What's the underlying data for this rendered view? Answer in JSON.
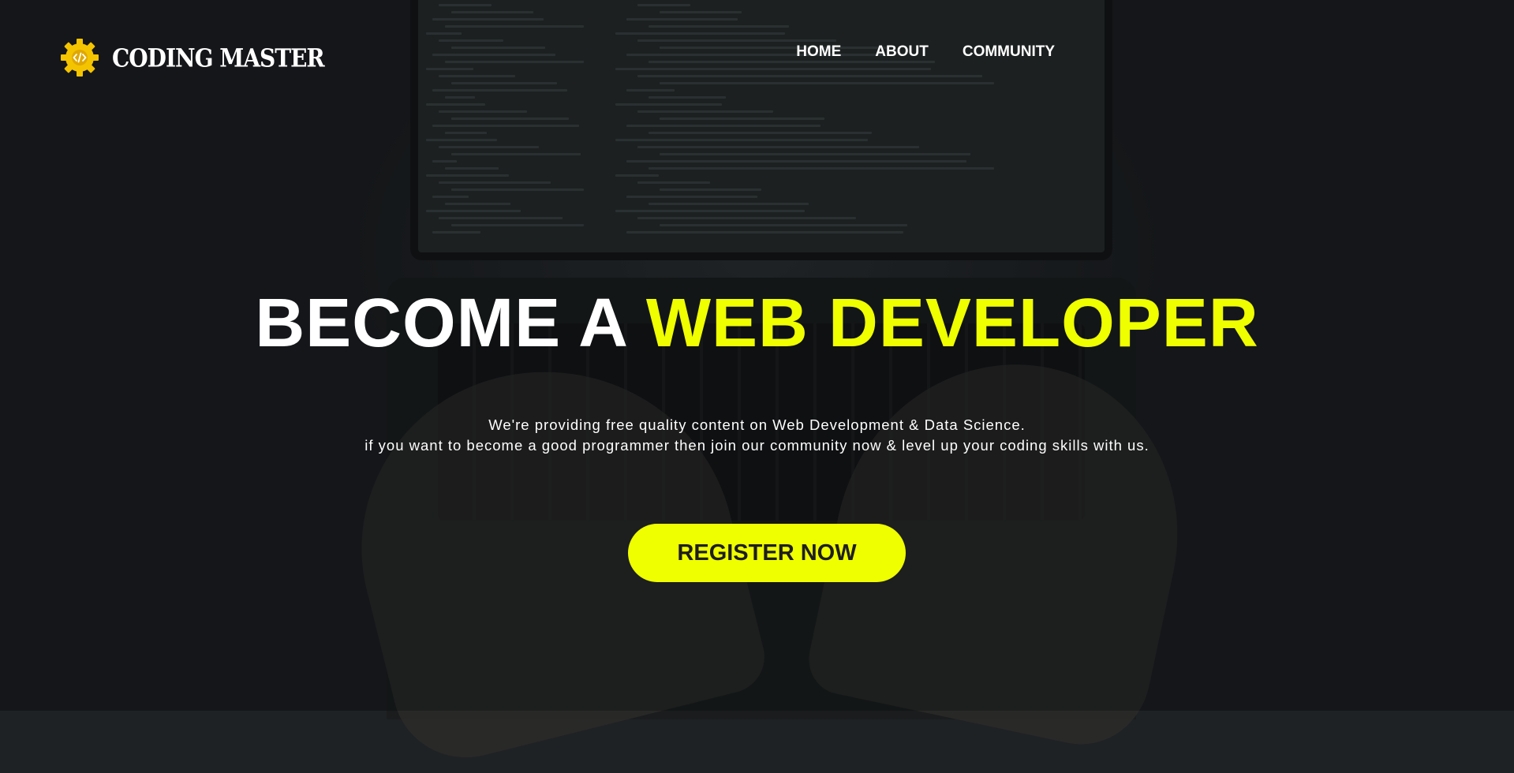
{
  "brand": {
    "name": "CODING MASTER",
    "logo_icon": "gear-code-icon",
    "accent_color": "#f0ff00"
  },
  "nav": {
    "items": [
      {
        "label": "HOME"
      },
      {
        "label": "ABOUT"
      },
      {
        "label": "COMMUNITY"
      }
    ]
  },
  "hero": {
    "title_main": "BECOME A",
    "title_accent": "WEB DEVELOPER",
    "subtitle_line1": "We're providing free quality content on Web Development & Data Science.",
    "subtitle_line2": "if you want to become a good programmer then join our community now & level up your coding skills with us.",
    "cta_label": "REGISTER NOW"
  }
}
